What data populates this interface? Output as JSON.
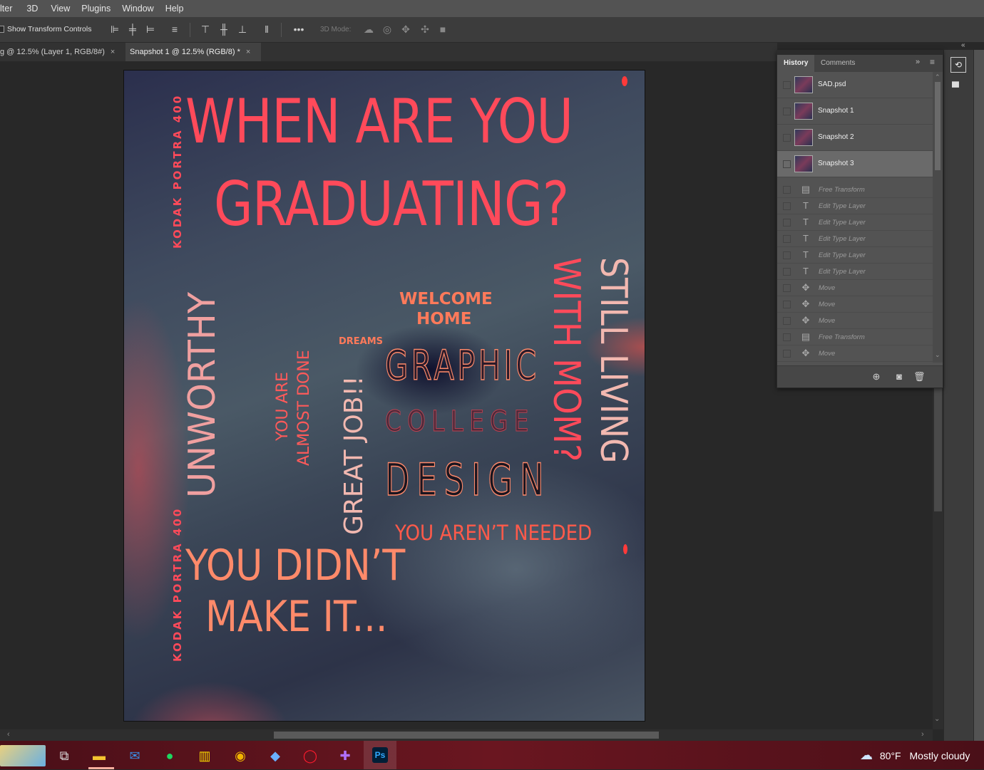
{
  "menubar": {
    "items": [
      "lter",
      "3D",
      "View",
      "Plugins",
      "Window",
      "Help"
    ]
  },
  "options_bar": {
    "show_transform_controls": "Show Transform Controls",
    "mode_3d": "3D Mode:"
  },
  "doc_tabs": [
    {
      "label": "g @ 12.5% (Layer 1, RGB/8#)",
      "close": "×"
    },
    {
      "label": "Snapshot 1 @ 12.5% (RGB/8) *",
      "close": "×"
    }
  ],
  "poster": {
    "title_line1": "WHEN ARE YOU",
    "title_line2": "GRADUATING?",
    "kodak_top": "KODAK   PORTRA 400",
    "kodak_bottom": "KODAK   PORTRA 400",
    "unworthy": "UNWORTHY",
    "almost_done_1": "YOU ARE",
    "almost_done_2": "ALMOST DONE",
    "great_job": "GREAT JOB!!",
    "welcome_1": "WELCOME",
    "welcome_2": "HOME",
    "dreams": "DREAMS",
    "graphic": "GRAPHIC",
    "college": "COLLEGE",
    "design": "DESIGN",
    "with_mom": "WITH MOM?",
    "still_living": "STILL LIVING",
    "not_needed": "YOU AREN’T NEEDED",
    "didnt_1": "YOU DIDN’T",
    "didnt_2": "MAKE IT..."
  },
  "history_panel": {
    "tabs": [
      "History",
      "Comments"
    ],
    "active_tab": "History",
    "snapshots": [
      "SAD.psd",
      "Snapshot 1",
      "Snapshot 2",
      "Snapshot 3"
    ],
    "selected_snapshot": "Snapshot 3",
    "steps": [
      {
        "label": "Free Transform",
        "icon": "document-icon"
      },
      {
        "label": "Edit Type Layer",
        "icon": "type-icon"
      },
      {
        "label": "Edit Type Layer",
        "icon": "type-icon"
      },
      {
        "label": "Edit Type Layer",
        "icon": "type-icon"
      },
      {
        "label": "Edit Type Layer",
        "icon": "type-icon"
      },
      {
        "label": "Edit Type Layer",
        "icon": "type-icon"
      },
      {
        "label": "Move",
        "icon": "move-icon"
      },
      {
        "label": "Move",
        "icon": "move-icon"
      },
      {
        "label": "Move",
        "icon": "move-icon"
      },
      {
        "label": "Free Transform",
        "icon": "document-icon"
      },
      {
        "label": "Move",
        "icon": "move-icon"
      }
    ]
  },
  "taskbar": {
    "weather_temp": "80°F",
    "weather_text": "Mostly cloudy",
    "ps_label": "Ps"
  },
  "colors": {
    "accent_red": "#ff4a5a",
    "salmon": "#ff8a6a",
    "pink_light": "#f2b8b0",
    "ps_blue": "#31a8ff"
  }
}
